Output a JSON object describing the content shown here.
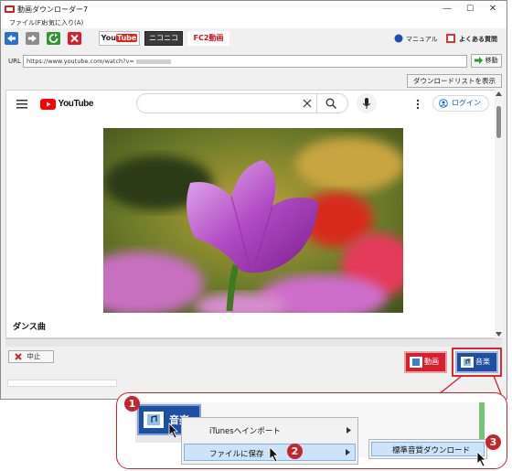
{
  "window": {
    "title": "動画ダウンローダー7",
    "controls": {
      "minimize": "—",
      "maximize": "☐",
      "close": "✕"
    }
  },
  "menu": {
    "file": "ファイル(F)",
    "favorites": "お気に入り(A)"
  },
  "toolbar": {
    "back_icon": "back-arrow-icon",
    "forward_icon": "forward-arrow-icon",
    "refresh_icon": "refresh-icon",
    "stop_icon": "close-icon",
    "sites": {
      "youtube_you": "You",
      "youtube_tube": "Tube",
      "niconico": "ニコニコ",
      "fc2": "FC2動画"
    },
    "manual": "マニュアル",
    "faq": "よくある質問"
  },
  "urlbar": {
    "label": "URL",
    "value": "https://www.youtube.com/watch?v=",
    "go_label": "移動"
  },
  "download_list_button": "ダウンロードリストを表示",
  "youtube": {
    "logo_text": "YouTube",
    "login_label": "ログイン"
  },
  "video": {
    "title": "ダンス曲"
  },
  "controls": {
    "stop_label": "中止",
    "video_button": "動画",
    "music_button": "音楽"
  },
  "callout": {
    "steps": [
      "1",
      "2",
      "3"
    ],
    "music_button": "音楽",
    "context_menu": {
      "itunes_import": "iTunesへインポート",
      "save_to_file": "ファイルに保存"
    },
    "submenu": {
      "standard_quality": "標準音質ダウンロード"
    }
  },
  "colors": {
    "accent_red": "#c2272d",
    "youtube_red": "#ff0000",
    "video_button": "#d71f2f",
    "music_button": "#1e4fa1",
    "go_green": "#2e9a2e"
  }
}
